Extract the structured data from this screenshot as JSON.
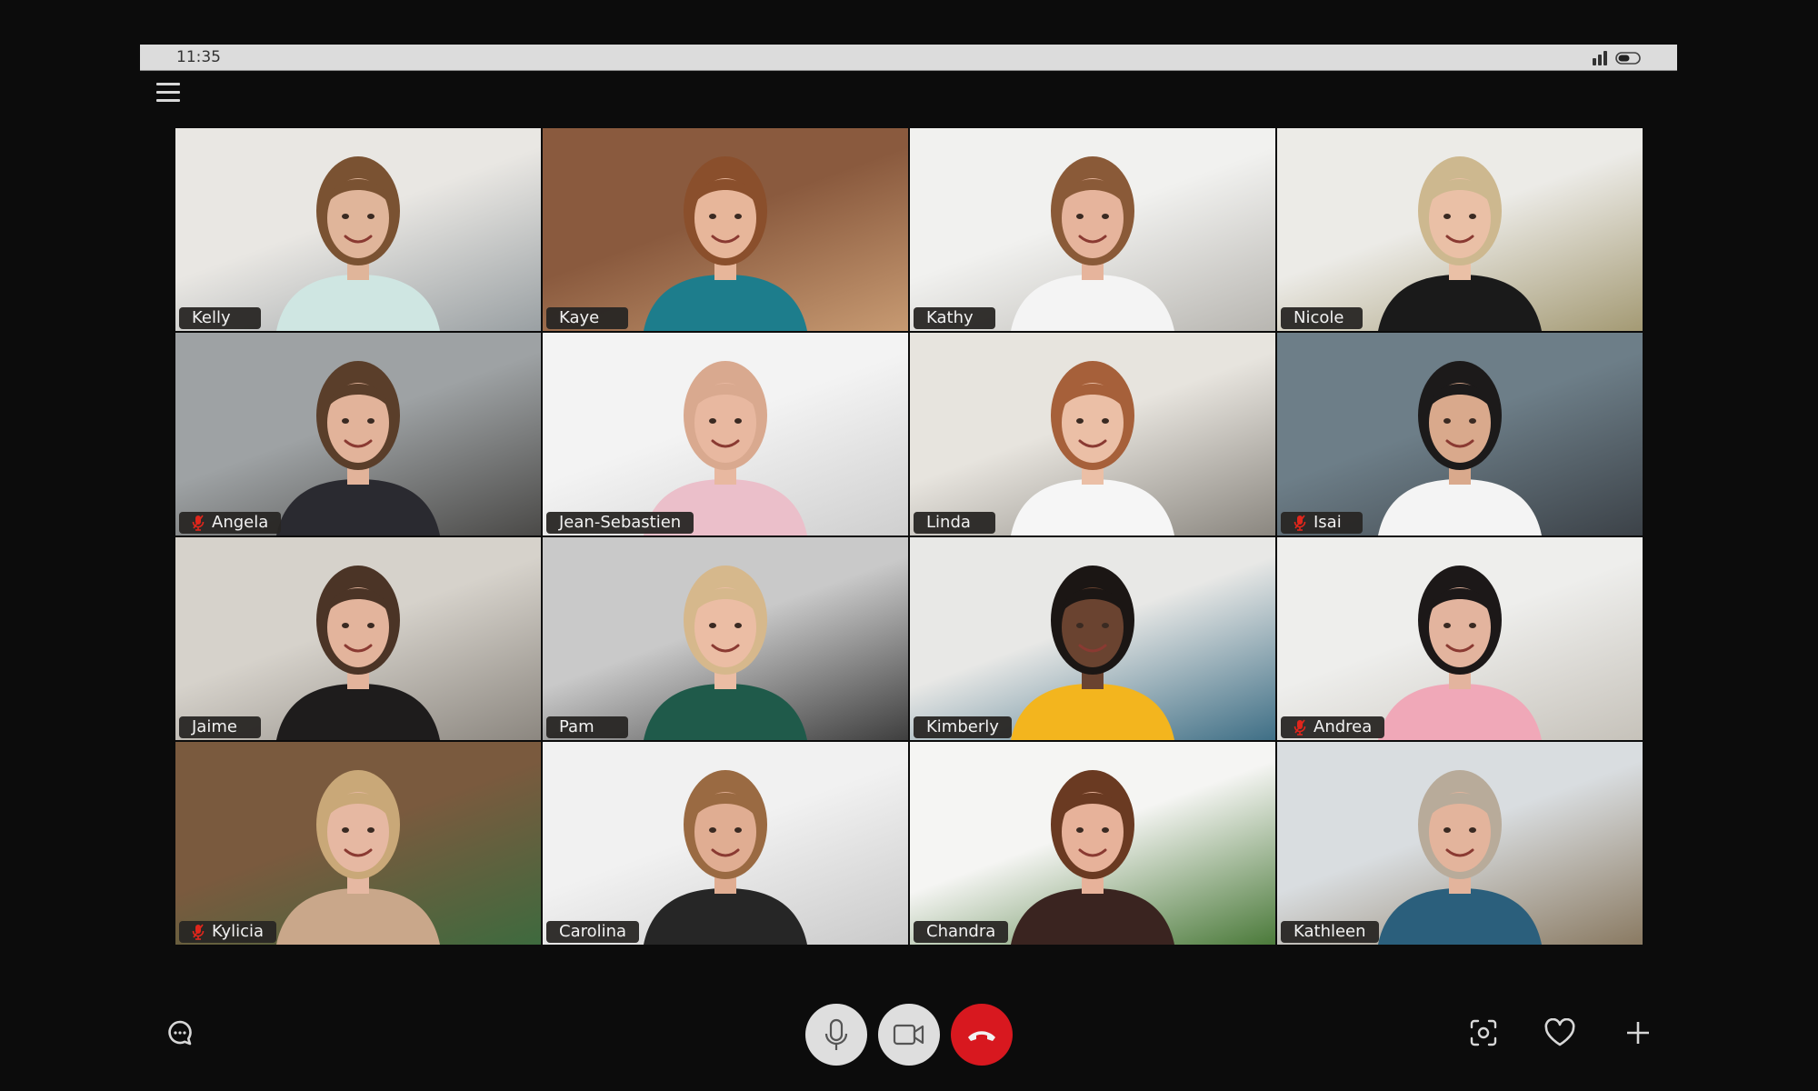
{
  "status_bar": {
    "time": "11:35",
    "signal_icon": "signal-bars-icon",
    "battery_icon": "battery-icon"
  },
  "menu": {
    "icon": "hamburger-menu-icon"
  },
  "participants": [
    {
      "name": "Kelly",
      "muted": false,
      "scene": [
        "#e9e7e3",
        "#9aa0a3"
      ],
      "shirt": "#cfe6e2",
      "hair": "#7a5232",
      "skin": "#e0b59a"
    },
    {
      "name": "Kaye",
      "muted": false,
      "scene": [
        "#8a5a3e",
        "#c79a72"
      ],
      "shirt": "#1d7d8c",
      "hair": "#8a4f2c",
      "skin": "#e7b69a"
    },
    {
      "name": "Kathy",
      "muted": false,
      "scene": [
        "#f1f1ef",
        "#b8b6b1"
      ],
      "shirt": "#f4f4f4",
      "hair": "#8a5a38",
      "skin": "#e6b49c"
    },
    {
      "name": "Nicole",
      "muted": false,
      "scene": [
        "#ecebe7",
        "#a49a74"
      ],
      "shirt": "#1a1a1a",
      "hair": "#cdb88f",
      "skin": "#eac0a6"
    },
    {
      "name": "Angela",
      "muted": true,
      "scene": [
        "#9ea2a4",
        "#4b4a48"
      ],
      "shirt": "#2a2a30",
      "hair": "#5a3e2a",
      "skin": "#e2b39a"
    },
    {
      "name": "Jean-Sebastien",
      "muted": false,
      "scene": [
        "#f3f3f3",
        "#cfcfcf"
      ],
      "shirt": "#ebbfca",
      "hair": "#d9a98f",
      "skin": "#e8b8a0"
    },
    {
      "name": "Linda",
      "muted": false,
      "scene": [
        "#e7e4de",
        "#8b8780"
      ],
      "shirt": "#f6f6f6",
      "hair": "#a6603a",
      "skin": "#ebbfa6"
    },
    {
      "name": "Isai",
      "muted": true,
      "scene": [
        "#6d7e88",
        "#3c4248"
      ],
      "shirt": "#f4f4f4",
      "hair": "#1c1a1a",
      "skin": "#d9a98c"
    },
    {
      "name": "Jaime",
      "muted": false,
      "scene": [
        "#d6d2cb",
        "#8c8780"
      ],
      "shirt": "#1e1c1c",
      "hair": "#4b3426",
      "skin": "#e3b49c"
    },
    {
      "name": "Pam",
      "muted": false,
      "scene": [
        "#c9c9c9",
        "#3f3f3f"
      ],
      "shirt": "#1f5a4a",
      "hair": "#d6b88c",
      "skin": "#ebbda4"
    },
    {
      "name": "Kimberly",
      "muted": false,
      "scene": [
        "#e8e8e6",
        "#3f6f86"
      ],
      "shirt": "#f3b51e",
      "hair": "#1b1614",
      "skin": "#6a4330"
    },
    {
      "name": "Andrea",
      "muted": true,
      "scene": [
        "#eeeeec",
        "#c6c2ba"
      ],
      "shirt": "#f0a8b8",
      "hair": "#1c1818",
      "skin": "#e3b49e"
    },
    {
      "name": "Kylicia",
      "muted": true,
      "scene": [
        "#7a5a3e",
        "#3e6a3e"
      ],
      "shirt": "#c9a78a",
      "hair": "#c9a878",
      "skin": "#e6b8a2"
    },
    {
      "name": "Carolina",
      "muted": false,
      "scene": [
        "#f1f1f1",
        "#cacaca"
      ],
      "shirt": "#262626",
      "hair": "#9a6a42",
      "skin": "#e0ad92"
    },
    {
      "name": "Chandra",
      "muted": false,
      "scene": [
        "#f5f5f3",
        "#4b7a3a"
      ],
      "shirt": "#3a2420",
      "hair": "#6a3a22",
      "skin": "#e7b29a"
    },
    {
      "name": "Kathleen",
      "muted": false,
      "scene": [
        "#d9dde0",
        "#8a7a62"
      ],
      "shirt": "#2b5f7c",
      "hair": "#b8ab9a",
      "skin": "#e3b49c"
    }
  ],
  "controls": {
    "chat": {
      "icon": "chat-bubble-icon"
    },
    "mic": {
      "icon": "microphone-icon"
    },
    "video": {
      "icon": "video-camera-icon"
    },
    "hangup": {
      "icon": "phone-hangup-icon",
      "color": "#d8181f"
    },
    "screenshot": {
      "icon": "screenshot-capture-icon"
    },
    "favorite": {
      "icon": "heart-icon"
    },
    "add": {
      "icon": "plus-icon"
    }
  },
  "colors": {
    "background": "#0c0c0c",
    "status_bar": "#dcdcdc",
    "label_bg": "#282624",
    "muted_icon": "#e0261c"
  }
}
